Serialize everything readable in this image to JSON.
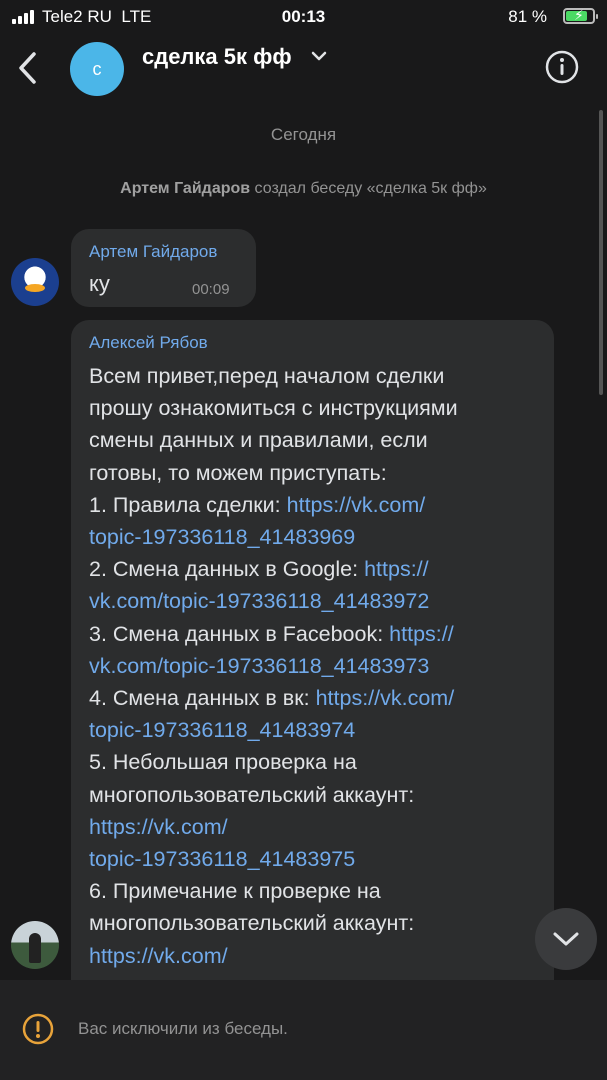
{
  "status_bar": {
    "carrier": "Tele2 RU",
    "network": "LTE",
    "time": "00:13",
    "battery": "81 %",
    "battery_level": 0.81
  },
  "header": {
    "avatar_letter": "с",
    "title": "сделка 5к фф",
    "icons": [
      "back-icon",
      "chevron-down-icon",
      "info-icon"
    ]
  },
  "chat": {
    "date": "Сегодня",
    "service_message": {
      "actor": "Артем Гайдаров",
      "text": " создал беседу «сделка 5к фф»"
    },
    "messages": [
      {
        "sender": "Артем Гайдаров",
        "text": "ку",
        "time": "00:09"
      },
      {
        "sender": "Алексей Рябов",
        "lines": [
          {
            "text": "Всем привет,перед началом сделки"
          },
          {
            "text": "прошу ознакомиться с инструкциями"
          },
          {
            "text": "смены данных и правилами, если"
          },
          {
            "text": "готовы, то можем приступать:"
          },
          {
            "text": "1. Правила сделки: ",
            "link": "https://vk.com/"
          },
          {
            "link": "topic-197336118_41483969"
          },
          {
            "text": "2. Смена данных в Google: ",
            "link": "https://"
          },
          {
            "link": "vk.com/topic-197336118_41483972"
          },
          {
            "text": "3. Смена данных в Facebook: ",
            "link": "https://"
          },
          {
            "link": "vk.com/topic-197336118_41483973"
          },
          {
            "text": "4. Смена данных в вк: ",
            "link": "https://vk.com/"
          },
          {
            "link": "topic-197336118_41483974"
          },
          {
            "text": "5. Небольшая проверка на"
          },
          {
            "text": "многопользовательский аккаунт:"
          },
          {
            "link": "https://vk.com/"
          },
          {
            "link": "topic-197336118_41483975"
          },
          {
            "text": "6. Примечание к проверке на"
          },
          {
            "text": "многопользовательский аккаунт:"
          },
          {
            "link": "https://vk.com/"
          }
        ]
      }
    ]
  },
  "bottom_bar": {
    "text": "Вас исключили из беседы."
  },
  "colors": {
    "background": "#19191a",
    "bubble": "#2c2d2e",
    "link": "#71aaeb",
    "muted": "#939393",
    "alert": "#e8a33a"
  }
}
